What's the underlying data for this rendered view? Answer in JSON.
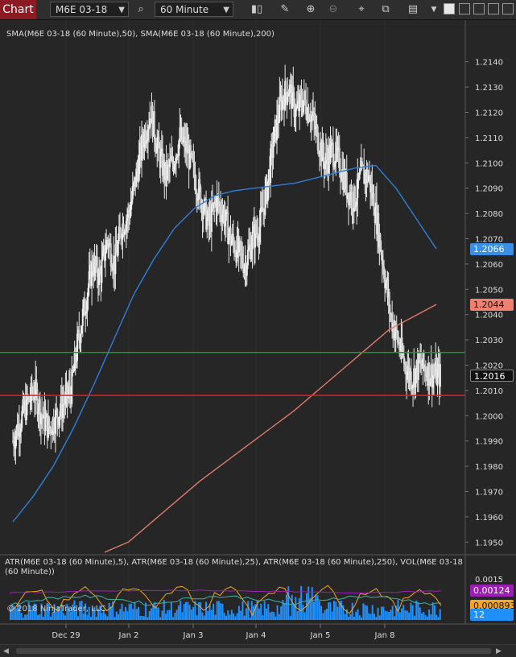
{
  "toolbar": {
    "tab_label": "Chart",
    "instrument": "M6E 03-18",
    "interval": "60 Minute"
  },
  "price_panel": {
    "indicator_label": "SMA(M6E 03-18 (60 Minute),50), SMA(M6E 03-18 (60 Minute),200)",
    "y_ticks": [
      "1.2140",
      "1.2130",
      "1.2120",
      "1.2110",
      "1.2100",
      "1.2090",
      "1.2080",
      "1.2070",
      "1.2060",
      "1.2050",
      "1.2040",
      "1.2030",
      "1.2020",
      "1.2010",
      "1.2000",
      "1.1990",
      "1.1980",
      "1.1970",
      "1.1960",
      "1.1950"
    ],
    "markers": [
      {
        "value": "1.2066",
        "color": "#3a8ee6",
        "text": "#ffffff"
      },
      {
        "value": "1.2044",
        "color": "#f08070",
        "text": "#111111"
      },
      {
        "value": "1.2016",
        "color": "#111111",
        "text": "#ffffff"
      }
    ]
  },
  "indicator_panel": {
    "label": "ATR(M6E 03-18 (60 Minute),5), ATR(M6E 03-18 (60 Minute),25), ATR(M6E 03-18 (60 Minute),250), VOL(M6E 03-18 (60 Minute))",
    "tick": "0.0015",
    "markers": [
      {
        "value": "0.00124",
        "color": "#9b1fb5",
        "text": "#ffffff"
      },
      {
        "value": "0.000893",
        "color": "#f5a623",
        "text": "#111111"
      },
      {
        "value": "12",
        "color": "#1e90ff",
        "text": "#ffffff"
      }
    ],
    "copyright": "© 2018 NinjaTrader, LLC"
  },
  "x_axis": {
    "labels": [
      "Dec 29",
      "Jan 2",
      "Jan 3",
      "Jan 4",
      "Jan 5",
      "Jan 8"
    ]
  },
  "chart_data": {
    "type": "line",
    "price_range": [
      1.1945,
      1.2145
    ],
    "h_lines": [
      {
        "value": 1.2025,
        "color": "#1f9a2a"
      },
      {
        "value": 1.2008,
        "color": "#e02020"
      }
    ],
    "closes": [
      1.199,
      1.1998,
      1.2005,
      1.201,
      1.2,
      1.1995,
      1.2,
      1.2005,
      1.201,
      1.203,
      1.2045,
      1.206,
      1.2055,
      1.207,
      1.206,
      1.2075,
      1.208,
      1.2095,
      1.211,
      1.212,
      1.2105,
      1.2095,
      1.21,
      1.211,
      1.2105,
      1.2095,
      1.2085,
      1.2075,
      1.2085,
      1.208,
      1.207,
      1.2065,
      1.206,
      1.207,
      1.2075,
      1.209,
      1.211,
      1.2125,
      1.213,
      1.212,
      1.2125,
      1.212,
      1.211,
      1.21,
      1.2105,
      1.21,
      1.209,
      1.2085,
      1.2095,
      1.2095,
      1.208,
      1.206,
      1.204,
      1.203,
      1.202,
      1.2015,
      1.202,
      1.2018,
      1.2016
    ],
    "sma50": {
      "color": "#2f7fd8",
      "values": [
        1.1958,
        1.1968,
        1.198,
        1.1995,
        1.2012,
        1.203,
        1.2048,
        1.2062,
        1.2074,
        1.2082,
        1.2087,
        1.2089,
        1.209,
        1.2091,
        1.2092,
        1.2094,
        1.2096,
        1.2098,
        1.2099,
        1.209,
        1.2078,
        1.2066
      ]
    },
    "sma200": {
      "color": "#e07a6a",
      "values": [
        1.1946,
        1.195,
        1.1958,
        1.1966,
        1.1974,
        1.1981,
        1.1988,
        1.1995,
        1.2002,
        1.201,
        1.2018,
        1.2026,
        1.2034,
        1.2039,
        1.2044
      ]
    }
  }
}
